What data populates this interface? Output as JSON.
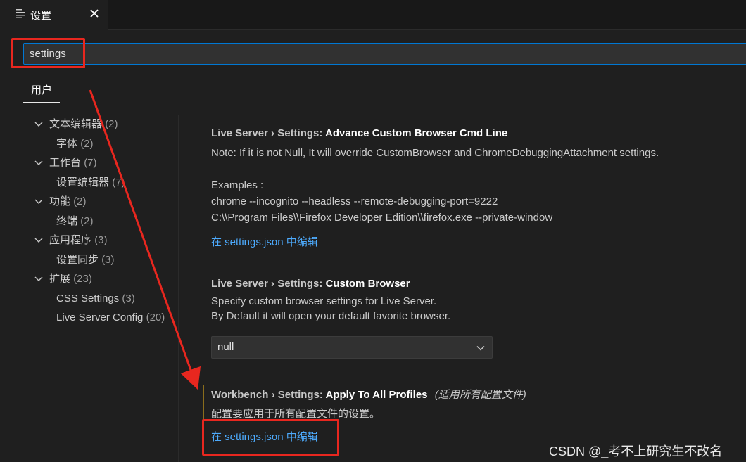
{
  "tab": {
    "icon": "settings-list-icon",
    "label": "设置",
    "close_icon": "close-icon"
  },
  "search": {
    "value": "settings",
    "placeholder": ""
  },
  "scope_tab": {
    "label": "用户"
  },
  "toc": [
    {
      "label": "文本编辑器",
      "count": "(2)",
      "level": 0,
      "expanded": true
    },
    {
      "label": "字体",
      "count": "(2)",
      "level": 1
    },
    {
      "label": "工作台",
      "count": "(7)",
      "level": 0,
      "expanded": true
    },
    {
      "label": "设置编辑器",
      "count": "(7)",
      "level": 1
    },
    {
      "label": "功能",
      "count": "(2)",
      "level": 0,
      "expanded": true
    },
    {
      "label": "终端",
      "count": "(2)",
      "level": 1
    },
    {
      "label": "应用程序",
      "count": "(3)",
      "level": 0,
      "expanded": true
    },
    {
      "label": "设置同步",
      "count": "(3)",
      "level": 1
    },
    {
      "label": "扩展",
      "count": "(23)",
      "level": 0,
      "expanded": true
    },
    {
      "label": "CSS Settings",
      "count": "(3)",
      "level": 1
    },
    {
      "label": "Live Server Config",
      "count": "(20)",
      "level": 1
    }
  ],
  "settings": [
    {
      "category": "Live Server › Settings: ",
      "name": "Advance Custom Browser Cmd Line",
      "desc": [
        "Note: If it is not Null, It will override CustomBrowser and ChromeDebuggingAttachment settings.",
        "",
        "Examples :",
        "chrome --incognito --headless --remote-debugging-port=9222",
        "C:\\\\Program Files\\\\Firefox Developer Edition\\\\firefox.exe --private-window"
      ],
      "link": "在 settings.json 中编辑"
    },
    {
      "category": "Live Server › Settings: ",
      "name": "Custom Browser",
      "desc": [
        "Specify custom browser settings for Live Server.",
        "By Default it will open your default favorite browser."
      ],
      "dropdown_value": "null"
    },
    {
      "category": "Workbench › Settings: ",
      "name": "Apply To All Profiles",
      "tag": "(适用所有配置文件)",
      "desc": [
        "配置要应用于所有配置文件的设置。"
      ],
      "link": "在 settings.json 中编辑"
    }
  ],
  "annotations": {
    "color": "#e8271f"
  },
  "watermark": "CSDN @_考不上研究生不改名"
}
